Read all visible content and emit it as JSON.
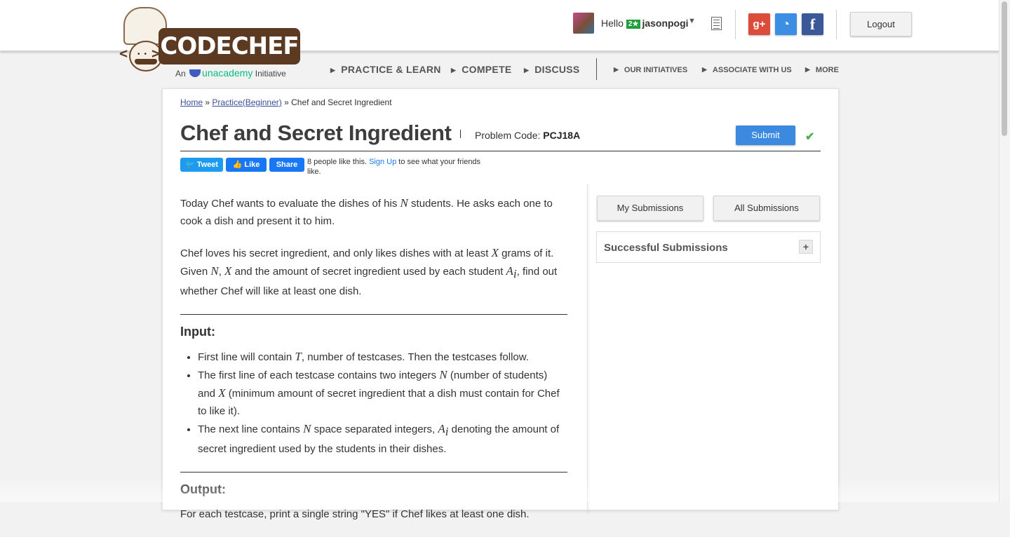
{
  "header": {
    "logo": {
      "wordmark": "CODECHEF",
      "initiative_prefix": "An",
      "initiative_brand": "unacademy",
      "initiative_suffix": "Initiative"
    },
    "user": {
      "greeting": "Hello",
      "rating_badge": "2★",
      "username": "jasonpogi"
    },
    "social": {
      "gplus": "g+",
      "github": "◔",
      "facebook": "f"
    },
    "logout_label": "Logout",
    "nav": {
      "practice": "PRACTICE & LEARN",
      "compete": "COMPETE",
      "discuss": "DISCUSS",
      "initiatives": "OUR INITIATIVES",
      "associate": "ASSOCIATE WITH US",
      "more": "MORE"
    },
    "colors": {
      "brand_brown": "#5b3a21",
      "accent_blue": "#3b8ae0"
    }
  },
  "breadcrumb": {
    "home": "Home",
    "sep1": "»",
    "practice": "Practice(Beginner)",
    "sep2": "»",
    "current": "Chef and Secret Ingredient"
  },
  "problem": {
    "title": "Chef and Secret Ingredient",
    "code_label": "Problem Code:",
    "code": "PCJ18A",
    "submit_label": "Submit"
  },
  "social_share": {
    "tweet": "Tweet",
    "like": "Like",
    "share": "Share",
    "likes_text": "8 people like this.",
    "signup": "Sign Up",
    "likes_suffix": "to see what your friends like."
  },
  "statement": {
    "p1_a": "Today Chef wants to evaluate the dishes of his ",
    "p1_n": "N",
    "p1_b": " students. He asks each one to cook a dish and present it to him.",
    "p2_a": "Chef loves his secret ingredient, and only likes dishes with at least ",
    "p2_x": "X",
    "p2_b": " grams of it. Given ",
    "p2_n": "N",
    "p2_c": ", ",
    "p2_x2": "X",
    "p2_d": " and the amount of secret ingredient used by each student ",
    "p2_a_var": "A",
    "p2_i": "i",
    "p2_e": ", find out whether Chef will like at least one dish.",
    "input_heading": "Input:",
    "in1_a": "First line will contain ",
    "in1_t": "T",
    "in1_b": ", number of testcases. Then the testcases follow.",
    "in2_a": "The first line of each testcase contains two integers ",
    "in2_n": "N",
    "in2_b": " (number of students) and ",
    "in2_x": "X",
    "in2_c": " (minimum amount of secret ingredient that a dish must contain for Chef to like it).",
    "in3_a": "The next line contains ",
    "in3_n": "N",
    "in3_b": " space separated integers, ",
    "in3_a_var": "A",
    "in3_i": "i",
    "in3_c": " denoting the amount of secret ingredient used by the students in their dishes.",
    "output_heading": "Output:",
    "out1": "For each testcase, print a single string \"YES\" if Chef likes at least one dish."
  },
  "sidebar": {
    "my_submissions": "My Submissions",
    "all_submissions": "All Submissions",
    "successful_submissions": "Successful Submissions",
    "expand": "+"
  }
}
